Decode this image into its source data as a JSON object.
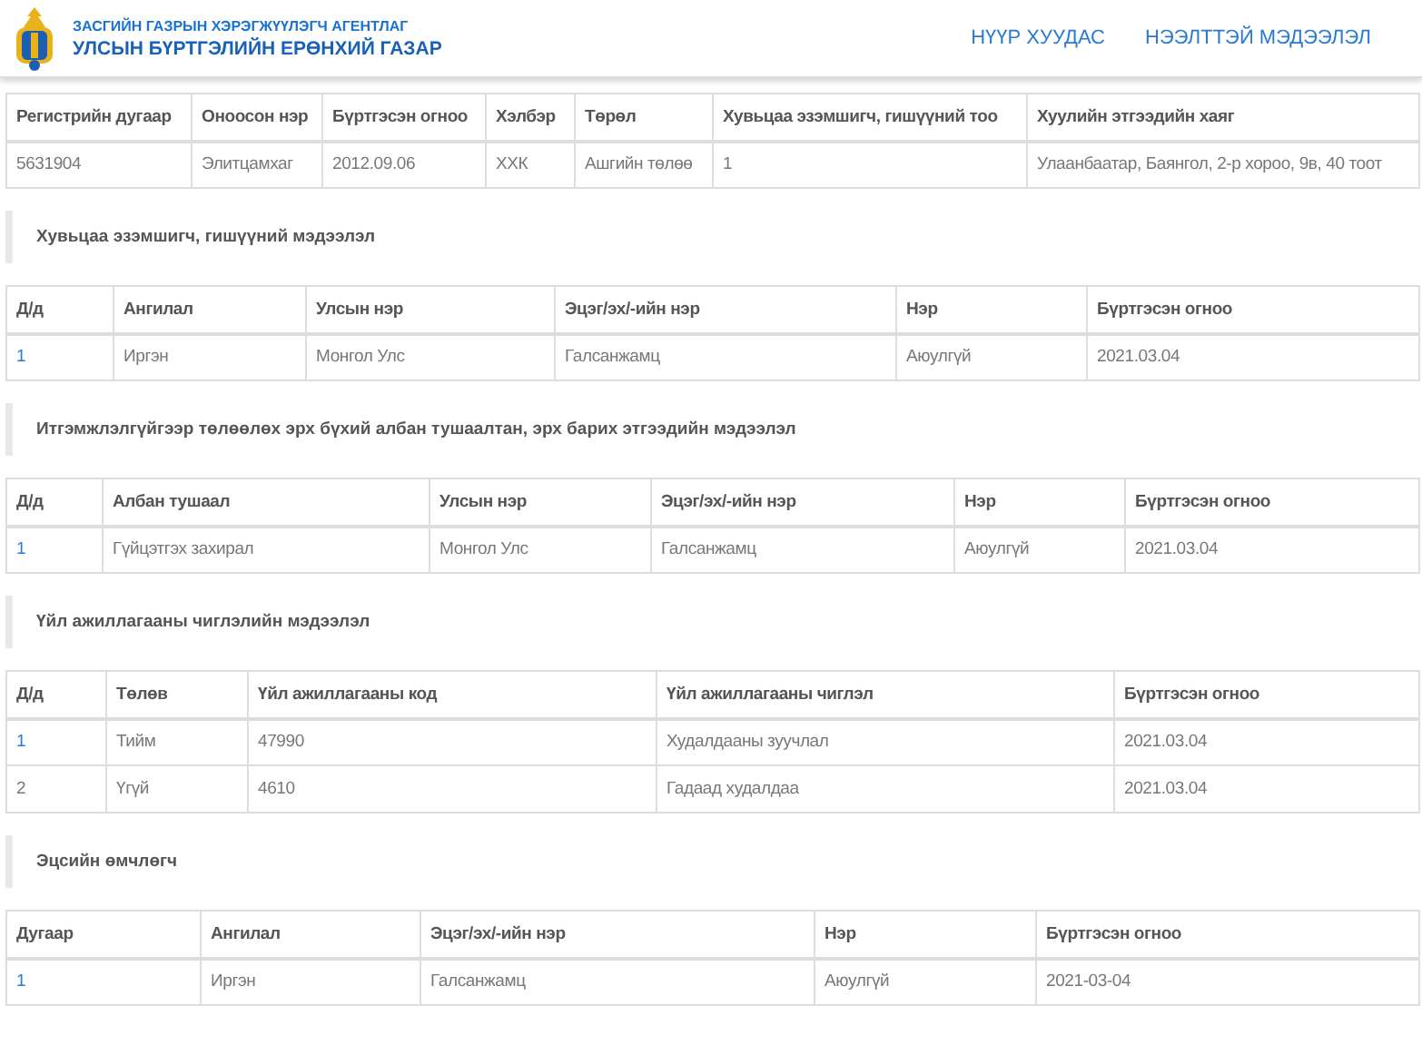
{
  "header": {
    "agency": "ЗАСГИЙН ГАЗРЫН ХЭРЭГЖҮҮЛЭГЧ АГЕНТЛАГ",
    "title": "УЛСЫН БҮРТГЭЛИЙН ЕРӨНХИЙ ГАЗАР",
    "nav": [
      "НҮҮР ХУУДАС",
      "НЭЭЛТТЭЙ МЭДЭЭЛЭЛ"
    ]
  },
  "sections": [
    {
      "columns": [
        "Регистрийн дугаар",
        "Оноосон нэр",
        "Бүртгэсэн огноо",
        "Хэлбэр",
        "Төрөл",
        "Хувьцаа эзэмшигч, гишүүний тоо",
        "Хуулийн этгээдийн хаяг"
      ],
      "rows": [
        {
          "linked": false,
          "cells": [
            "5631904",
            "Элитцамхаг",
            "2012.09.06",
            "ХХК",
            "Ашгийн төлөө",
            "1",
            "Улаанбаатар, Баянгол, 2-р хороо, 9в, 40 тоот"
          ]
        }
      ]
    },
    {
      "title": "Хувьцаа эзэмшигч, гишүүний мэдээлэл",
      "columns": [
        "Д/д",
        "Ангилал",
        "Улсын нэр",
        "Эцэг/эх/-ийн нэр",
        "Нэр",
        "Бүртгэсэн огноо"
      ],
      "rows": [
        {
          "linked": true,
          "cells": [
            "1",
            "Иргэн",
            "Монгол Улс",
            "Галсанжамц",
            "Аюулгүй",
            "2021.03.04"
          ]
        }
      ]
    },
    {
      "title": "Итгэмжлэлгүйгээр төлөөлөх эрх бүхий албан тушаалтан, эрх барих этгээдийн мэдээлэл",
      "columns": [
        "Д/д",
        "Албан тушаал",
        "Улсын нэр",
        "Эцэг/эх/-ийн нэр",
        "Нэр",
        "Бүртгэсэн огноо"
      ],
      "rows": [
        {
          "linked": true,
          "cells": [
            "1",
            "Гүйцэтгэх захирал",
            "Монгол Улс",
            "Галсанжамц",
            "Аюулгүй",
            "2021.03.04"
          ]
        }
      ]
    },
    {
      "title": "Үйл ажиллагааны чиглэлийн мэдээлэл",
      "columns": [
        "Д/д",
        "Төлөв",
        "Үйл ажиллагааны код",
        "Үйл ажиллагааны чиглэл",
        "Бүртгэсэн огноо"
      ],
      "rows": [
        {
          "linked": true,
          "cells": [
            "1",
            "Тийм",
            "47990",
            "Худалдааны зуучлал",
            "2021.03.04"
          ]
        },
        {
          "linked": false,
          "cells": [
            "2",
            "Үгүй",
            "4610",
            "Гадаад худалдаа",
            "2021.03.04"
          ]
        }
      ]
    },
    {
      "title": "Эцсийн өмчлөгч",
      "columns": [
        "Дугаар",
        "Ангилал",
        "Эцэг/эх/-ийн нэр",
        "Нэр",
        "Бүртгэсэн огноо"
      ],
      "rows": [
        {
          "linked": true,
          "cells": [
            "1",
            "Иргэн",
            "Галсанжамц",
            "Аюулгүй",
            "2021-03-04"
          ]
        }
      ]
    }
  ]
}
